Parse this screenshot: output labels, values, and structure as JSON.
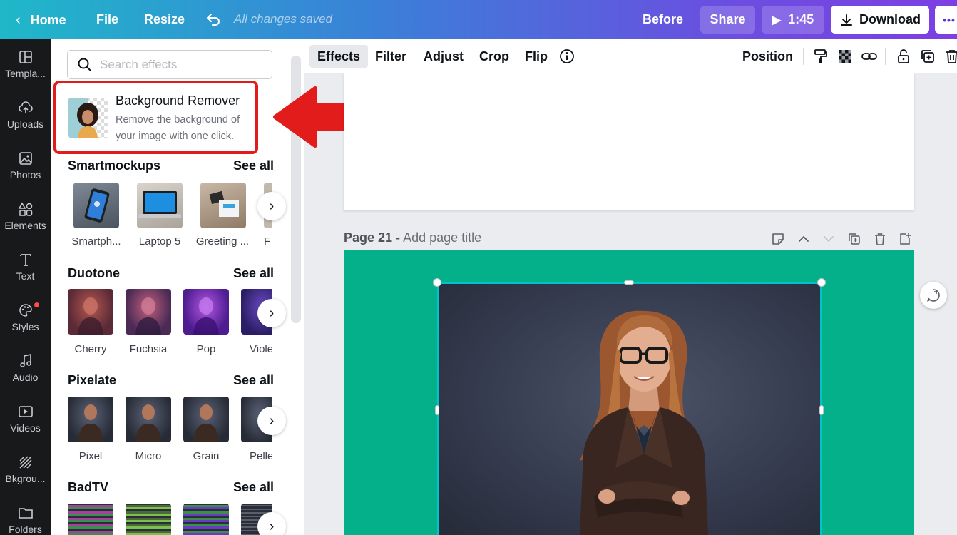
{
  "topbar": {
    "home": "Home",
    "file": "File",
    "resize": "Resize",
    "saved": "All changes saved",
    "before": "Before",
    "share": "Share",
    "play_time": "1:45",
    "download": "Download",
    "more": "•••"
  },
  "rail": {
    "items": [
      {
        "label": "Templa...",
        "icon": "template-icon"
      },
      {
        "label": "Uploads",
        "icon": "cloud-upload-icon"
      },
      {
        "label": "Photos",
        "icon": "image-icon"
      },
      {
        "label": "Elements",
        "icon": "shapes-icon"
      },
      {
        "label": "Text",
        "icon": "text-icon"
      },
      {
        "label": "Styles",
        "icon": "palette-icon"
      },
      {
        "label": "Audio",
        "icon": "music-icon"
      },
      {
        "label": "Videos",
        "icon": "video-icon"
      },
      {
        "label": "Bkgrou...",
        "icon": "background-icon"
      },
      {
        "label": "Folders",
        "icon": "folder-icon"
      }
    ]
  },
  "panel": {
    "search_placeholder": "Search effects",
    "bg_remover": {
      "title": "Background Remover",
      "desc": "Remove the background of your image with one click."
    },
    "sections": [
      {
        "title": "Smartmockups",
        "see_all": "See all",
        "items": [
          "Smartph...",
          "Laptop 5",
          "Greeting ...",
          "F"
        ]
      },
      {
        "title": "Duotone",
        "see_all": "See all",
        "items": [
          "Cherry",
          "Fuchsia",
          "Pop",
          "Viole"
        ]
      },
      {
        "title": "Pixelate",
        "see_all": "See all",
        "items": [
          "Pixel",
          "Micro",
          "Grain",
          "Pelle"
        ]
      },
      {
        "title": "BadTV",
        "see_all": "See all",
        "items": []
      }
    ]
  },
  "toolbar": {
    "effects": "Effects",
    "filter": "Filter",
    "adjust": "Adjust",
    "crop": "Crop",
    "flip": "Flip",
    "position": "Position"
  },
  "canvas": {
    "page_number": "Page 21 -",
    "page_title_placeholder": "Add page title"
  },
  "colors": {
    "accent_red": "#e21b1b",
    "page_green": "#03b08a",
    "selection": "#00c4cc"
  }
}
